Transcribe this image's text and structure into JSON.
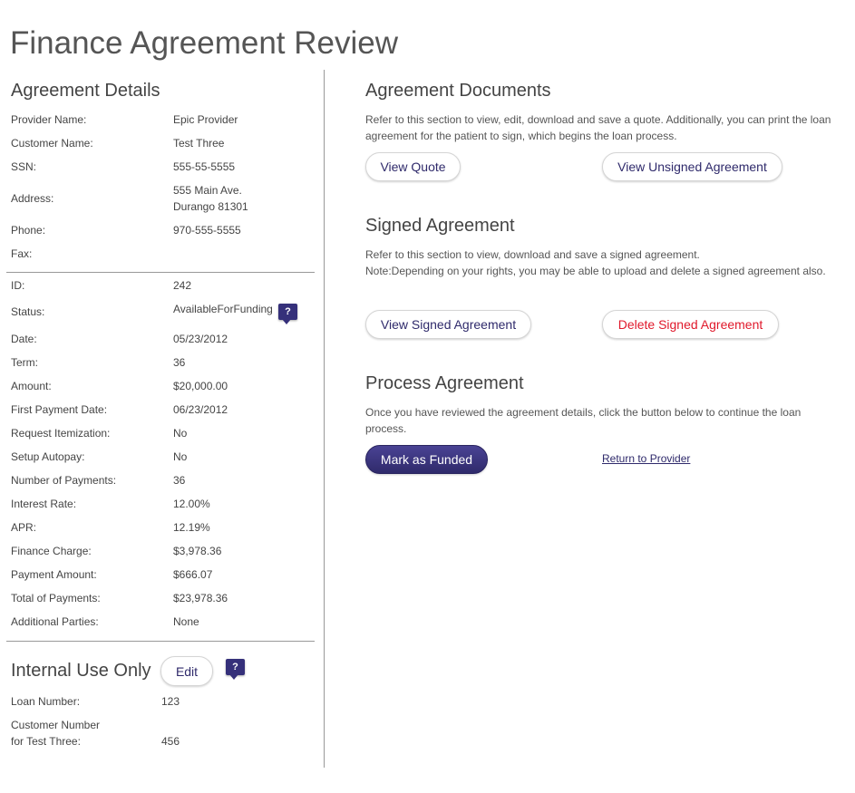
{
  "page_title": "Finance Agreement Review",
  "details": {
    "title": "Agreement Details",
    "group1": [
      {
        "label": "Provider Name:",
        "value": "Epic Provider"
      },
      {
        "label": "Customer Name:",
        "value": "Test Three"
      },
      {
        "label": "SSN:",
        "value": "555-55-5555"
      },
      {
        "label": "Address:",
        "value": "555 Main Ave.",
        "value2": "Durango 81301"
      },
      {
        "label": "Phone:",
        "value": "970-555-5555"
      },
      {
        "label": "Fax:",
        "value": ""
      }
    ],
    "group2": [
      {
        "label": "ID:",
        "value": "242"
      },
      {
        "label": "Status:",
        "value": "AvailableForFunding"
      },
      {
        "label": "Date:",
        "value": "05/23/2012"
      },
      {
        "label": "Term:",
        "value": "36"
      },
      {
        "label": "Amount:",
        "value": "$20,000.00"
      },
      {
        "label": "First Payment Date:",
        "value": "06/23/2012"
      },
      {
        "label": "Request Itemization:",
        "value": "No"
      },
      {
        "label": "Setup Autopay:",
        "value": "No"
      },
      {
        "label": "Number of Payments:",
        "value": "36"
      },
      {
        "label": "Interest Rate:",
        "value": "12.00%"
      },
      {
        "label": "APR:",
        "value": "12.19%"
      },
      {
        "label": "Finance Charge:",
        "value": "$3,978.36"
      },
      {
        "label": "Payment Amount:",
        "value": "$666.07"
      },
      {
        "label": "Total of Payments:",
        "value": "$23,978.36"
      },
      {
        "label": "Additional Parties:",
        "value": "None"
      }
    ]
  },
  "internal": {
    "title": "Internal Use Only",
    "edit_label": "Edit",
    "loan_number_label": "Loan Number:",
    "loan_number_value": "123",
    "customer_number_label_line1": "Customer Number",
    "customer_number_label_line2": "for Test Three:",
    "customer_number_value": "456"
  },
  "help_icon": {
    "glyph": "?",
    "icon": "help-icon"
  },
  "documents": {
    "title": "Agreement Documents",
    "description_line1": "Refer to this section to view, edit, download and save a quote. Additionally, you can print the loan",
    "description_line2": "agreement for the patient to sign, which begins the loan process.",
    "view_quote_label": "View Quote",
    "view_unsigned_label": "View Unsigned Agreement"
  },
  "signed": {
    "title": "Signed Agreement",
    "description_line1": "Refer to this section to view, download and save a signed agreement.",
    "description_line2": "Note:Depending on your rights, you may be able to upload and delete a signed agreement also.",
    "view_signed_label": "View Signed Agreement",
    "delete_signed_label": "Delete Signed Agreement"
  },
  "process": {
    "title": "Process Agreement",
    "description_line1": "Once you have reviewed the agreement details, click the button below to continue the loan",
    "description_line2": "process.",
    "mark_funded_label": "Mark as Funded",
    "return_link_label": "Return to Provider"
  },
  "colors": {
    "accent": "#35307a",
    "danger": "#e0192b",
    "text": "#444444"
  }
}
